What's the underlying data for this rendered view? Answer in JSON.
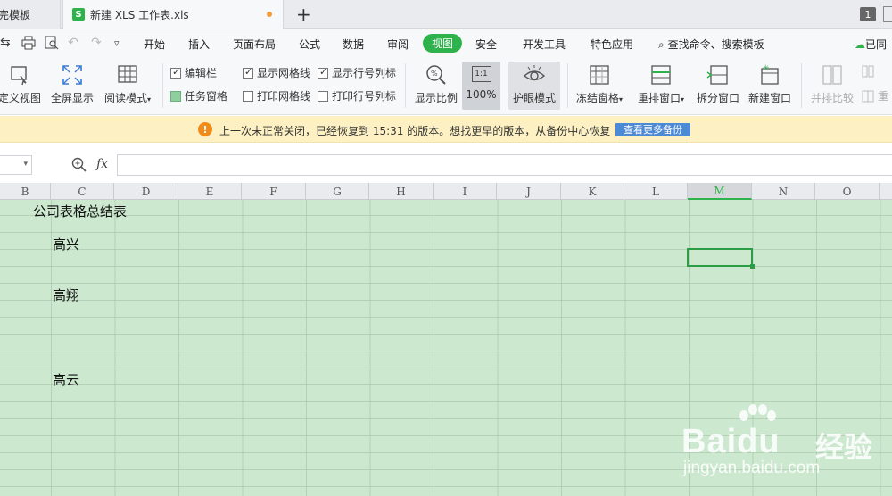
{
  "tabs": {
    "previous": "完模板",
    "active": "新建 XLS 工作表.xls",
    "active_logo": "S",
    "count": "1"
  },
  "menu": {
    "items": [
      "开始",
      "插入",
      "页面布局",
      "公式",
      "数据",
      "审阅",
      "视图",
      "安全",
      "开发工具",
      "特色应用"
    ],
    "active": "视图",
    "search": "查找命令、搜索模板",
    "right": "已同"
  },
  "ribbon": {
    "custom_view": "定义视图",
    "fullscreen": "全屏显示",
    "reading_mode": "阅读模式",
    "checks": {
      "edit_bar": "编辑栏",
      "task_pane": "任务窗格",
      "show_grid": "显示网格线",
      "print_grid": "打印网格线",
      "show_rowcol": "显示行号列标",
      "print_rowcol": "打印行号列标"
    },
    "zoom": "显示比例",
    "zoom_100": "100%",
    "zoom_100_icon": "1:1",
    "eye_mode": "护眼模式",
    "freeze": "冻结窗格",
    "arrange": "重排窗口",
    "split": "拆分窗口",
    "new_window": "新建窗口",
    "side_by_side": "并排比较",
    "reset_partial": "重"
  },
  "notification": {
    "icon": "!",
    "message": "上一次未正常关闭，已经恢复到 15:31 的版本。想找更早的版本，从备份中心恢复",
    "button": "查看更多备份"
  },
  "formula": {
    "fx": "fx"
  },
  "columns": [
    "B",
    "C",
    "D",
    "E",
    "F",
    "G",
    "H",
    "I",
    "J",
    "K",
    "L",
    "M",
    "N",
    "O"
  ],
  "selected_column": "M",
  "cells": {
    "title": "公司表格总结表",
    "name1": "高兴",
    "name2": "高翔",
    "name3": "高云"
  },
  "watermark": {
    "brand": "Bai",
    "brand_mid": "du",
    "brand_cn": "经验",
    "url": "jingyan.baidu.com"
  },
  "colors": {
    "accent": "#2eb24b",
    "grid_bg": "#cce8cf",
    "notify_bg": "#fdf0c2",
    "notify_btn": "#4d8ad6"
  }
}
